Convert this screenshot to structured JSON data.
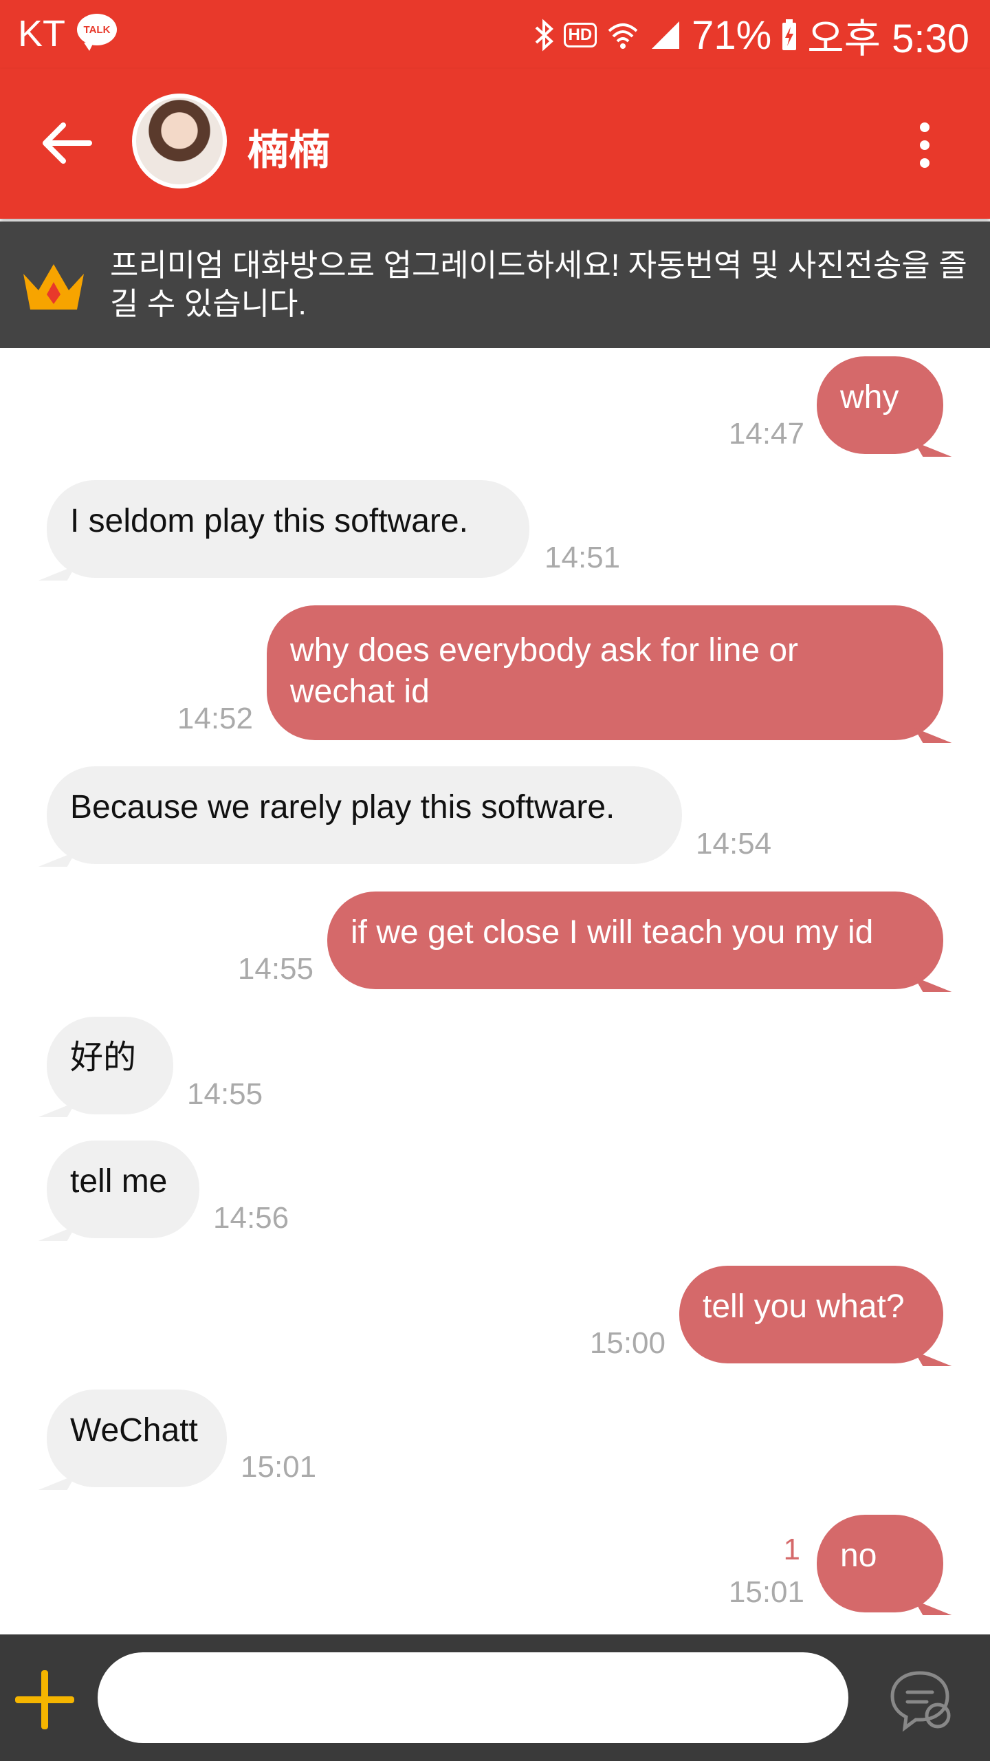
{
  "status_bar": {
    "carrier": "KT",
    "talk_badge": "TALK",
    "hd": "HD",
    "battery": "71%",
    "time": "오후 5:30"
  },
  "header": {
    "contact_name": "楠楠",
    "colors": {
      "bar": "#e8392b"
    }
  },
  "banner": {
    "text": "프리미엄 대화방으로 업그레이드하세요! 자동번역 및 사진전송을 즐길 수 있습니다."
  },
  "messages": [
    {
      "side": "out",
      "text": "why",
      "time": "14:47"
    },
    {
      "side": "in",
      "text": "I seldom play this software.",
      "time": "14:51"
    },
    {
      "side": "out",
      "text": "why does everybody ask for line or\nwechat id",
      "time": "14:52"
    },
    {
      "side": "in",
      "text": "Because we rarely play this software.",
      "time": "14:54"
    },
    {
      "side": "out",
      "text": "if we get close I will teach you my id",
      "time": "14:55"
    },
    {
      "side": "in",
      "text": "好的",
      "time": "14:55"
    },
    {
      "side": "in",
      "text": "tell me",
      "time": "14:56"
    },
    {
      "side": "out",
      "text": "tell you what?",
      "time": "15:00"
    },
    {
      "side": "in",
      "text": "WeChatt",
      "time": "15:01"
    },
    {
      "side": "out",
      "text": "no",
      "time": "15:01",
      "unread": "1"
    }
  ],
  "input": {
    "placeholder": ""
  },
  "icons": {
    "back": "arrow-left-icon",
    "more": "more-vertical-icon",
    "crown": "crown-icon",
    "plus": "plus-icon",
    "emoji": "chat-bubble-icon"
  }
}
